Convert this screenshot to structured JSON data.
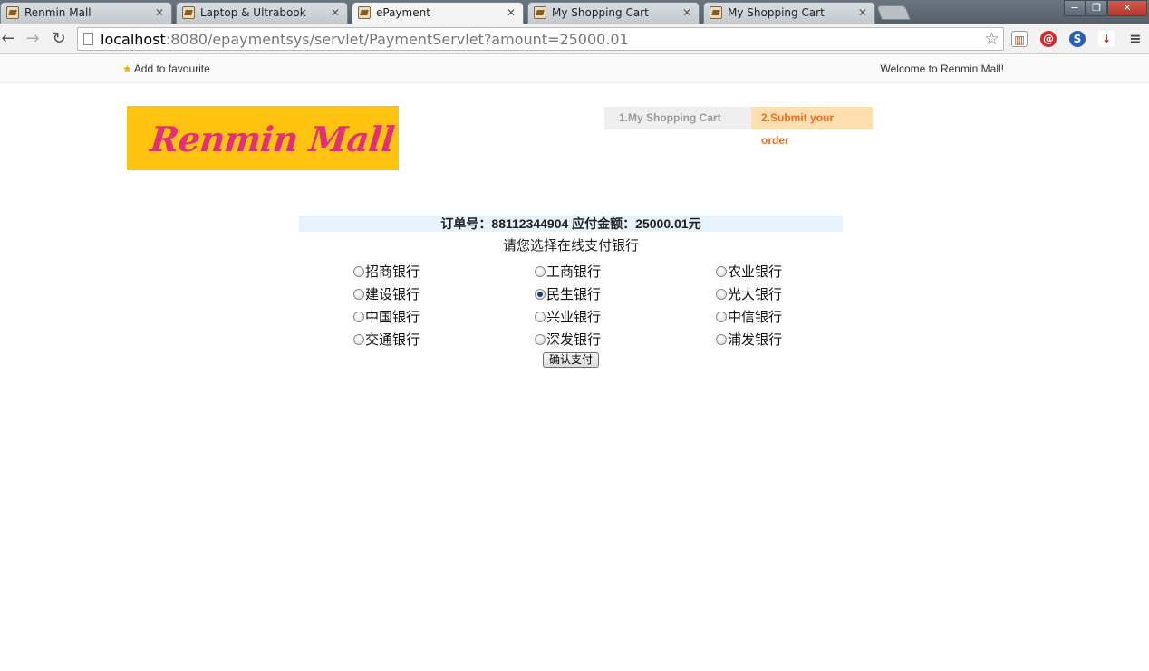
{
  "browser": {
    "tabs": [
      {
        "title": "Renmin Mall"
      },
      {
        "title": "Laptop & Ultrabook"
      },
      {
        "title": "ePayment"
      },
      {
        "title": "My Shopping Cart"
      },
      {
        "title": "My Shopping Cart"
      }
    ],
    "active_tab": 2,
    "url_host": "localhost",
    "url_rest": ":8080/epaymentsys/servlet/PaymentServlet?amount=25000.01",
    "window_controls": {
      "minimize": "−",
      "restore": "❐",
      "close": "✕"
    }
  },
  "topbar": {
    "favourite_label": "Add to favourite",
    "welcome_text": "Welcome to Renmin Mall!"
  },
  "logo": {
    "text": "Renmin Mall"
  },
  "steps": [
    {
      "label": "1.My Shopping Cart"
    },
    {
      "label": "2.Submit your order"
    }
  ],
  "order": {
    "summary": "订单号：88112344904 应付金额：25000.01元"
  },
  "prompt": "请您选择在线支付银行",
  "banks": [
    {
      "name": "招商银行",
      "checked": false
    },
    {
      "name": "工商银行",
      "checked": false
    },
    {
      "name": "农业银行",
      "checked": false
    },
    {
      "name": "建设银行",
      "checked": false
    },
    {
      "name": "民生银行",
      "checked": true
    },
    {
      "name": "光大银行",
      "checked": false
    },
    {
      "name": "中国银行",
      "checked": false
    },
    {
      "name": "兴业银行",
      "checked": false
    },
    {
      "name": "中信银行",
      "checked": false
    },
    {
      "name": "交通银行",
      "checked": false
    },
    {
      "name": "深发银行",
      "checked": false
    },
    {
      "name": "浦发银行",
      "checked": false
    }
  ],
  "confirm_label": "确认支付",
  "colors": {
    "logo_bg": "#ffc20e",
    "logo_text": "#e2317a",
    "step_active_bg": "#ffdfb0",
    "step_active_text": "#f26b1d",
    "order_bg": "#e6f2fc"
  }
}
